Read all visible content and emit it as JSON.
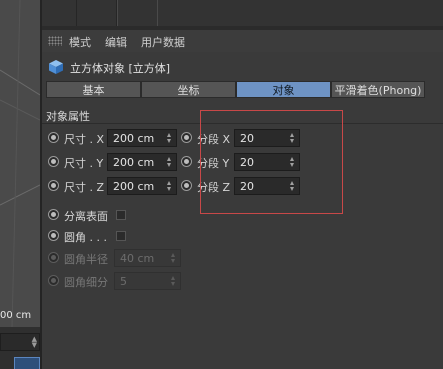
{
  "viewport": {
    "readout": "00 cm"
  },
  "menubar": {
    "items": [
      "模式",
      "编辑",
      "用户数据"
    ]
  },
  "object": {
    "title": "立方体对象 [立方体]"
  },
  "tabs": [
    {
      "label": "基本",
      "active": false
    },
    {
      "label": "坐标",
      "active": false
    },
    {
      "label": "对象",
      "active": true
    },
    {
      "label": "平滑着色(Phong)",
      "active": false
    }
  ],
  "section": {
    "title": "对象属性"
  },
  "size": {
    "x": {
      "label": "尺寸 . X",
      "value": "200 cm"
    },
    "y": {
      "label": "尺寸 . Y",
      "value": "200 cm"
    },
    "z": {
      "label": "尺寸 . Z",
      "value": "200 cm"
    }
  },
  "segments": {
    "x": {
      "label": "分段 X",
      "value": "20"
    },
    "y": {
      "label": "分段 Y",
      "value": "20"
    },
    "z": {
      "label": "分段 Z",
      "value": "20"
    }
  },
  "separate_surfaces": {
    "label": "分离表面",
    "checked": false
  },
  "fillet": {
    "label": "圆角 . . .",
    "checked": false
  },
  "fillet_radius": {
    "label": "圆角半径",
    "value": "40 cm",
    "enabled": false
  },
  "fillet_subdivision": {
    "label": "圆角细分",
    "value": "5",
    "enabled": false
  },
  "colors": {
    "accent_tab": "#6e93c4",
    "highlight_box": "#c84848",
    "cube_icon": "#4f8fd6"
  },
  "icons": {
    "cube": "cube-icon",
    "grip": "grip-icon"
  }
}
